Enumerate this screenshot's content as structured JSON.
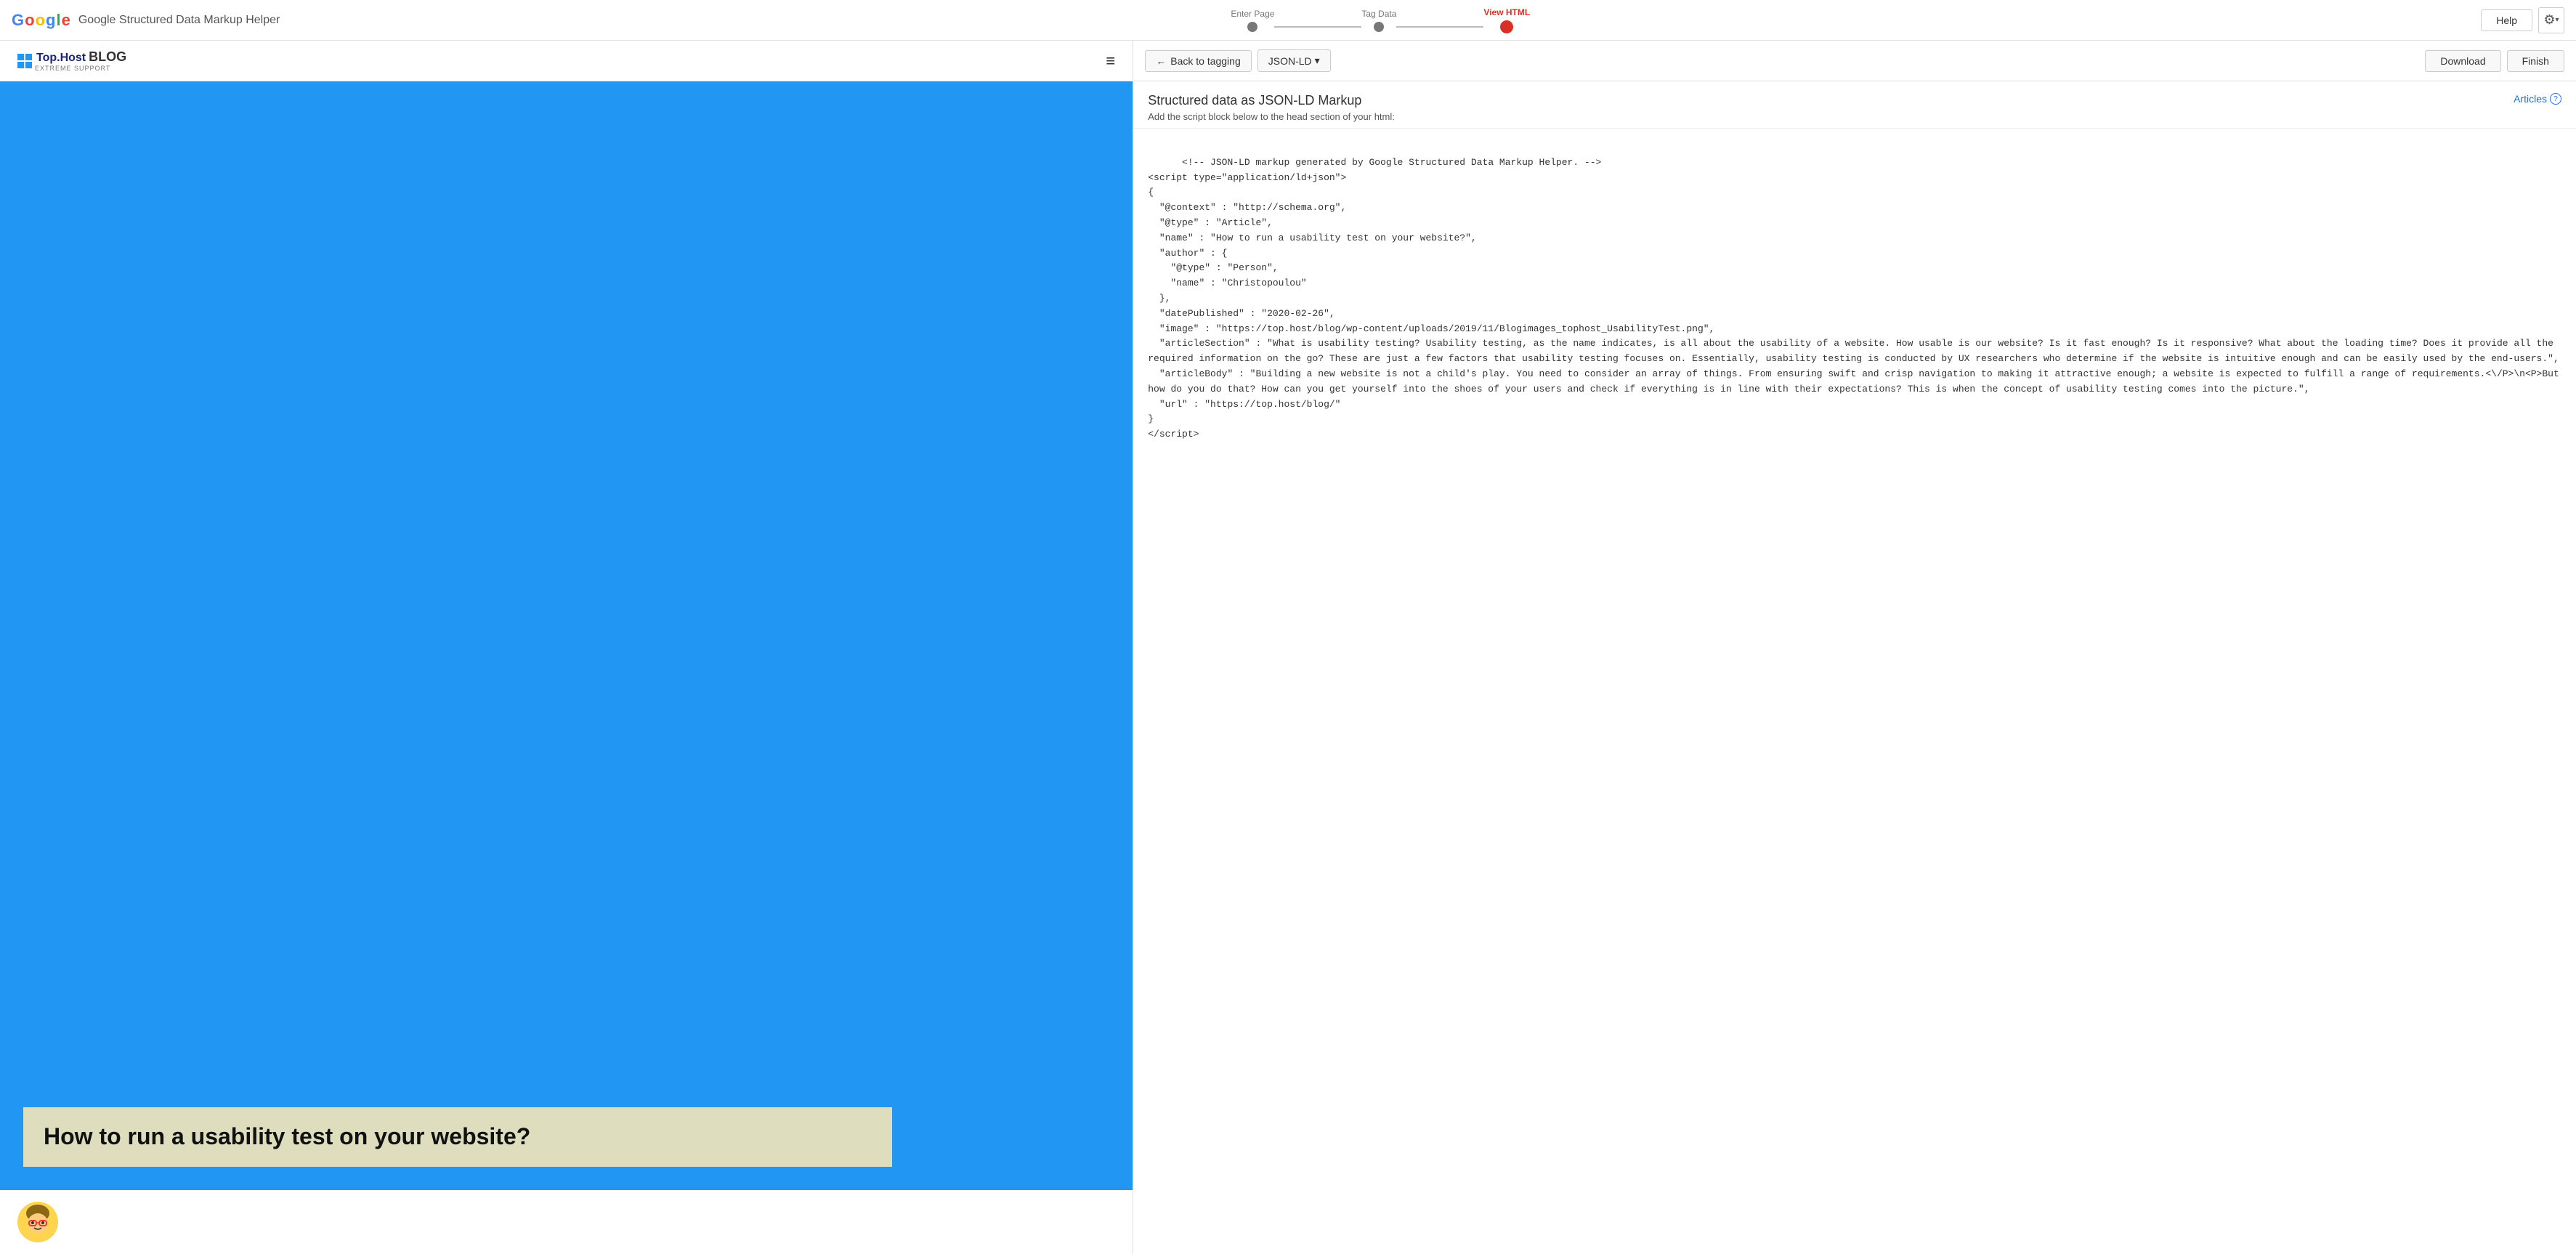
{
  "app": {
    "title": "Google Structured Data Markup Helper"
  },
  "google_logo": {
    "g": "G",
    "o1": "o",
    "o2": "o",
    "g2": "g",
    "l": "l",
    "e": "e"
  },
  "progress": {
    "steps": [
      {
        "label": "Enter Page",
        "state": "done"
      },
      {
        "label": "Tag Data",
        "state": "done"
      },
      {
        "label": "View HTML",
        "state": "active"
      }
    ]
  },
  "top_right": {
    "help_label": "Help",
    "settings_icon": "⚙"
  },
  "site_header": {
    "logo_text": "Top.Host",
    "logo_sub": "EXTREME SUPPORT",
    "blog_text": "BLOG",
    "hamburger": "≡"
  },
  "hero": {
    "title": "How to run a usability test on your website?"
  },
  "author": {
    "emoji": "👩"
  },
  "right_toolbar": {
    "back_label": "Back to tagging",
    "json_ld_label": "JSON-LD",
    "dropdown_icon": "▾",
    "download_label": "Download",
    "finish_label": "Finish"
  },
  "json_section": {
    "title": "Structured data as JSON-LD Markup",
    "subtitle": "Add the script block below to the head section of your html:",
    "articles_label": "Articles",
    "help_icon": "?"
  },
  "code_content": "<!-- JSON-LD markup generated by Google Structured Data Markup Helper. -->\n<script type=\"application/ld+json\">\n{\n  \"@context\" : \"http://schema.org\",\n  \"@type\" : \"Article\",\n  \"name\" : \"How to run a usability test on your website?\",\n  \"author\" : {\n    \"@type\" : \"Person\",\n    \"name\" : \"Christopoulou\"\n  },\n  \"datePublished\" : \"2020-02-26\",\n  \"image\" : \"https://top.host/blog/wp-content/uploads/2019/11/Blogimages_tophost_UsabilityTest.png\",\n  \"articleSection\" : \"What is usability testing? Usability testing, as the name indicates, is all about the usability of a website. How usable is our website? Is it fast enough? Is it responsive? What about the loading time? Does it provide all the required information on the go? These are just a few factors that usability testing focuses on. Essentially, usability testing is conducted by UX researchers who determine if the website is intuitive enough and can be easily used by the end-users.\",\n  \"articleBody\" : \"Building a new website is not a child's play. You need to consider an array of things. From ensuring swift and crisp navigation to making it attractive enough; a website is expected to fulfill a range of requirements.<\\/P>\\n<P>But how do you do that? How can you get yourself into the shoes of your users and check if everything is in line with their expectations? This is when the concept of usability testing comes into the picture.\",\n  \"url\" : \"https://top.host/blog/\"\n}\n</script>"
}
